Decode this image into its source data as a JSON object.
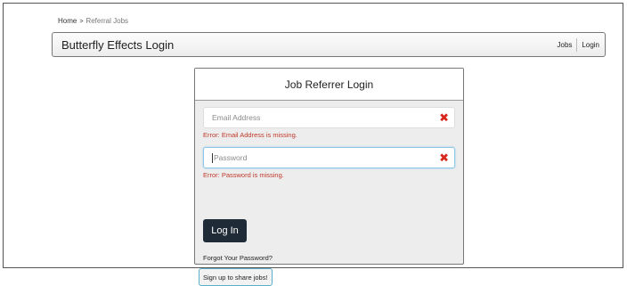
{
  "breadcrumb": {
    "home": "Home",
    "separator": ">",
    "current": "Referral Jobs"
  },
  "navbar": {
    "brand": "Butterfly Effects Login",
    "links": [
      "Jobs",
      "Login"
    ]
  },
  "panel": {
    "title": "Job Referrer Login",
    "email": {
      "placeholder": "Email Address",
      "error": "Error: Email Address is missing."
    },
    "password": {
      "placeholder": "Password",
      "error": "Error: Password is missing."
    },
    "login_label": "Log In",
    "forgot_label": "Forgot Your Password?",
    "signup_label": "Sign up to share jobs!"
  },
  "colors": {
    "error": "#c0392b",
    "invalid_icon": "#d9261c",
    "button": "#1f2b36",
    "focus": "#8ec6e8"
  },
  "icons": {
    "invalid": "x-icon"
  }
}
